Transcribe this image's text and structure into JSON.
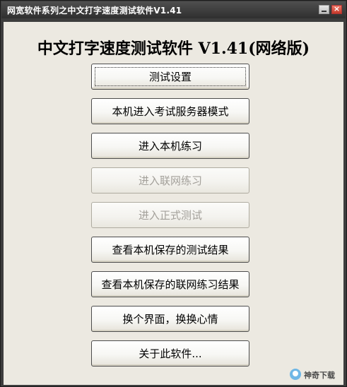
{
  "window": {
    "title": "网宽软件系列之中文打字速度测试软件V1.41",
    "minimize_symbol": "",
    "close_symbol": "×"
  },
  "app": {
    "heading": "中文打字速度测试软件 V1.41(网络版)"
  },
  "buttons": [
    {
      "label": "测试设置",
      "enabled": true,
      "focused": true
    },
    {
      "label": "本机进入考试服务器模式",
      "enabled": true
    },
    {
      "label": "进入本机练习",
      "enabled": true
    },
    {
      "label": "进入联网练习",
      "enabled": false
    },
    {
      "label": "进入正式测试",
      "enabled": false
    },
    {
      "label": "查看本机保存的测试结果",
      "enabled": true
    },
    {
      "label": "查看本机保存的联网练习结果",
      "enabled": true
    },
    {
      "label": "换个界面，换换心情",
      "enabled": true
    },
    {
      "label": "关于此软件...",
      "enabled": true
    }
  ],
  "watermark": {
    "text": "神奇下载"
  },
  "colors": {
    "titlebar": "#3d3d3d",
    "client_background": "#ece9e1",
    "disabled_text": "#a3a09a"
  }
}
